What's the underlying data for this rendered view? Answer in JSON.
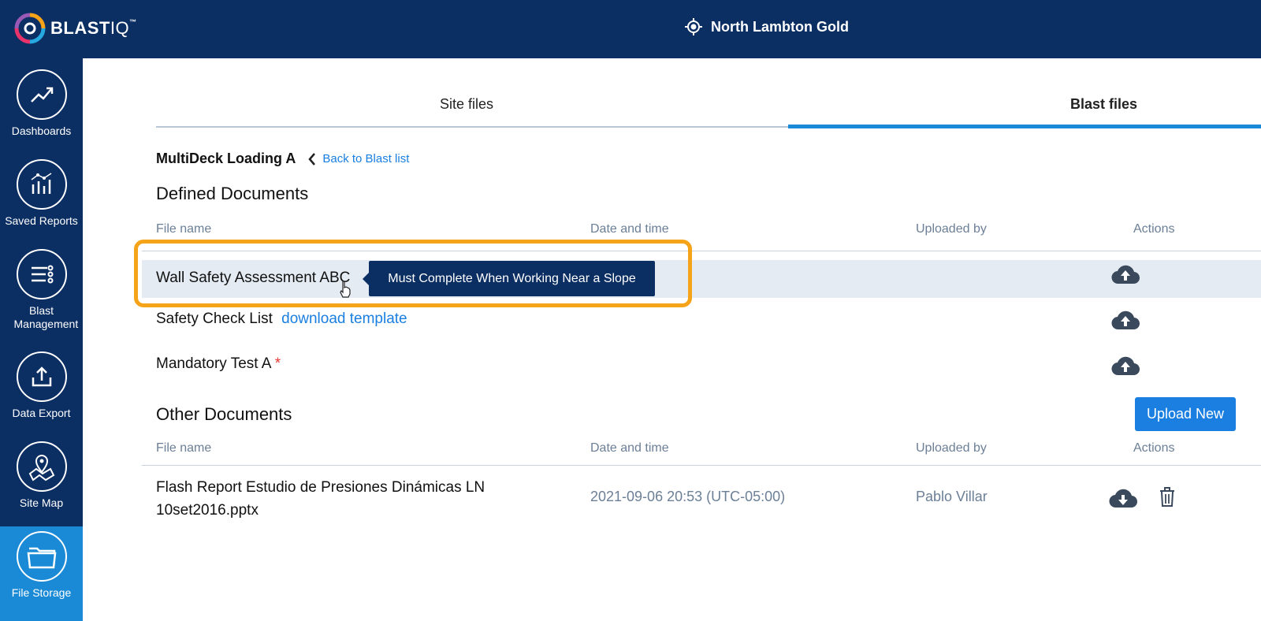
{
  "header": {
    "logo_blast": "BLAST",
    "logo_iq": "IQ",
    "logo_tm": "™",
    "site_name": "North Lambton Gold"
  },
  "sidebar": {
    "items": [
      {
        "label": "Dashboards",
        "icon": "trend-up-icon"
      },
      {
        "label": "Saved Reports",
        "icon": "bar-chart-icon"
      },
      {
        "label": "Blast Management",
        "icon": "list-settings-icon"
      },
      {
        "label": "Data Export",
        "icon": "export-icon"
      },
      {
        "label": "Site Map",
        "icon": "map-pin-icon"
      },
      {
        "label": "File Storage",
        "icon": "folder-icon",
        "active": true
      }
    ]
  },
  "tabs": {
    "site_files": "Site files",
    "blast_files": "Blast files",
    "active": "blast_files"
  },
  "breadcrumb": {
    "title": "MultiDeck Loading A",
    "back": "Back to Blast list"
  },
  "defined": {
    "title": "Defined Documents",
    "columns": [
      "File name",
      "Date and time",
      "Uploaded by",
      "Actions"
    ],
    "rows": [
      {
        "name": "Wall Safety Assessment ABC",
        "tooltip": "Must Complete When Working Near a Slope",
        "action": "upload-cloud-icon"
      },
      {
        "name": "Safety Check List",
        "link": "download template",
        "action": "upload-cloud-icon"
      },
      {
        "name": "Mandatory Test A",
        "required": "*",
        "action": "upload-cloud-icon"
      }
    ]
  },
  "other": {
    "title": "Other Documents",
    "upload_button": "Upload New",
    "columns": [
      "File name",
      "Date and time",
      "Uploaded by",
      "Actions"
    ],
    "rows": [
      {
        "name_line1": "Flash Report Estudio de Presiones Dinámicas LN",
        "name_line2": "10set2016.pptx",
        "date": "2021-09-06 20:53 (UTC-05:00)",
        "uploader": "Pablo Villar"
      }
    ]
  },
  "colors": {
    "navy": "#0b2e63",
    "accent_blue": "#1a8ad6",
    "link_blue": "#1a7fe0",
    "highlight_orange": "#f5a318"
  }
}
